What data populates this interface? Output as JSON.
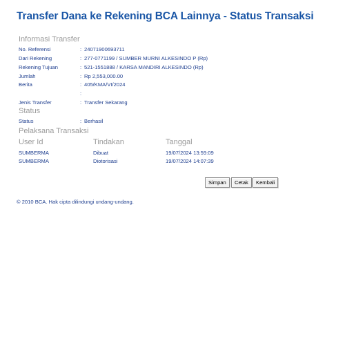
{
  "page": {
    "title": "Transfer Dana ke Rekening BCA Lainnya - Status Transaksi"
  },
  "info": {
    "heading": "Informasi Transfer",
    "rows": [
      {
        "label": "No. Referensi",
        "value": "24071900693711"
      },
      {
        "label": "Dari Rekening",
        "value": "277-0771199 / SUMBER MURNI ALKESINDO P  (Rp)"
      },
      {
        "label": "Rekening Tujuan",
        "value": "521-1551888 / KARSA MANDIRI ALKESINDO  (Rp)"
      },
      {
        "label": "Jumlah",
        "value": "Rp  2,553,000.00"
      },
      {
        "label": "Berita",
        "value": "405/KMA/VI/2024"
      },
      {
        "label": "",
        "value": ""
      },
      {
        "label": "Jenis Transfer",
        "value": "Transfer Sekarang"
      }
    ]
  },
  "status": {
    "heading": "Status",
    "label": "Status",
    "value": "Berhasil"
  },
  "pelaksana": {
    "heading": "Pelaksana Transaksi",
    "columns": [
      "User Id",
      "Tindakan",
      "Tanggal"
    ],
    "rows": [
      [
        "SUMBERMA",
        "Dibuat",
        "19/07/2024 13:59:09"
      ],
      [
        "SUMBERMA",
        "Diotorisasi",
        "19/07/2024 14:07:39"
      ]
    ]
  },
  "actions": {
    "simpan": "Simpan",
    "cetak": "Cetak",
    "kembali": "Kembali"
  },
  "footer": {
    "text": "©  2010 BCA. Hak cipta dilindungi undang-undang."
  },
  "colors": {
    "title": "#1a56a6",
    "text": "#1f3f8f",
    "heading": "#9b9b9b"
  }
}
